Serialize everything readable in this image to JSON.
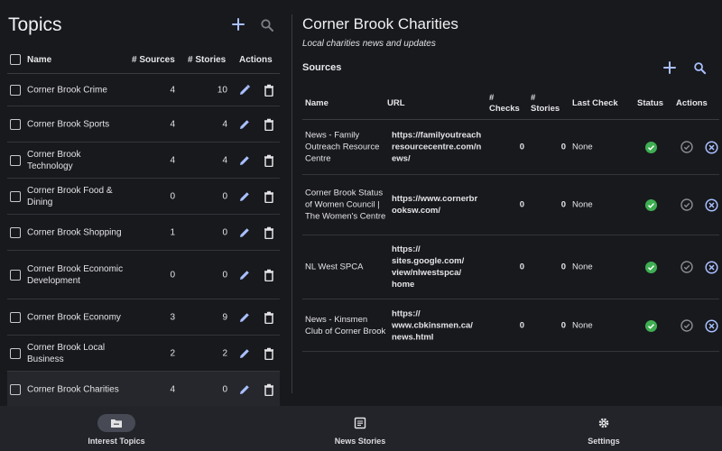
{
  "left": {
    "title": "Topics",
    "headers": {
      "name": "Name",
      "sources": "# Sources",
      "stories": "# Stories",
      "actions": "Actions"
    },
    "topics": [
      {
        "name": "Corner Brook Crime",
        "sources": "4",
        "stories": "10"
      },
      {
        "name": "Corner Brook Sports",
        "sources": "4",
        "stories": "4"
      },
      {
        "name": "Corner Brook Technology",
        "sources": "4",
        "stories": "4"
      },
      {
        "name": "Corner Brook Food & Dining",
        "sources": "0",
        "stories": "0"
      },
      {
        "name": "Corner Brook Shopping",
        "sources": "1",
        "stories": "0"
      },
      {
        "name": "Corner Brook Economic Development",
        "sources": "0",
        "stories": "0"
      },
      {
        "name": "Corner Brook Economy",
        "sources": "3",
        "stories": "9"
      },
      {
        "name": "Corner Brook Local Business",
        "sources": "2",
        "stories": "2"
      },
      {
        "name": "Corner Brook Charities",
        "sources": "4",
        "stories": "0"
      }
    ]
  },
  "right": {
    "title": "Corner Brook Charities",
    "subtitle": "Local charities news and updates",
    "sources_label": "Sources",
    "headers": {
      "name": "Name",
      "url": "URL",
      "checks": "# Checks",
      "stories": "# Stories",
      "last_check": "Last Check",
      "status": "Status",
      "actions": "Actions"
    },
    "sources": [
      {
        "name": "News - Family Outreach Resource Centre",
        "url": "https://familyoutreachresourcecentre.com/news/",
        "checks": "0",
        "stories": "0",
        "last_check": "None"
      },
      {
        "name": "Corner Brook Status of Women Council | The Women's Centre",
        "url": "https://www.cornerbrooksw.com/",
        "checks": "0",
        "stories": "0",
        "last_check": "None"
      },
      {
        "name": "NL West SPCA",
        "url": "https:// sites.google.com/ view/nlwestspca/ home",
        "checks": "0",
        "stories": "0",
        "last_check": "None"
      },
      {
        "name": "News - Kinsmen Club of Corner Brook",
        "url": "https:// www.cbkinsmen.ca/ news.html",
        "checks": "0",
        "stories": "0",
        "last_check": "None"
      }
    ]
  },
  "nav": {
    "topics": "Interest Topics",
    "stories": "News Stories",
    "settings": "Settings"
  },
  "colors": {
    "background": "#18191d",
    "bottom_bar": "#23242a",
    "status_ok": "#3fae52",
    "accent_icon": "#a9c0ff"
  }
}
